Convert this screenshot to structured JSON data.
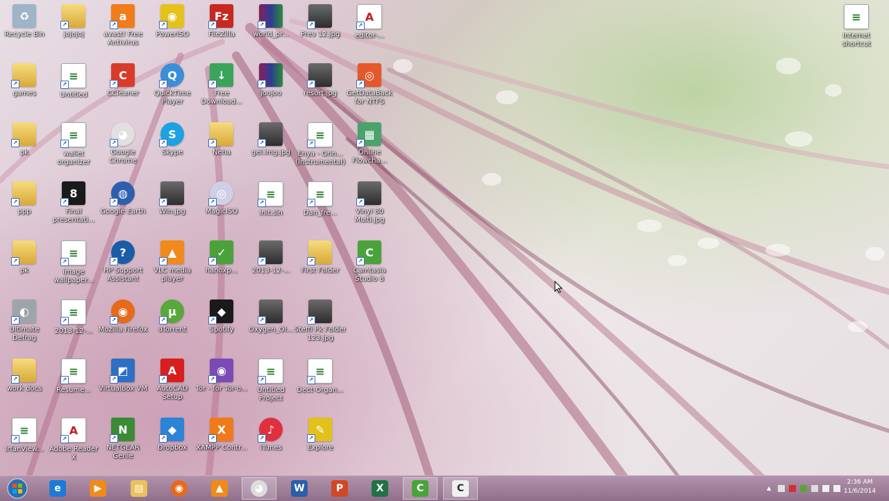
{
  "desktop": {
    "icons": [
      {
        "label": "Recycle Bin",
        "kind": "recycle",
        "color": "#9fb4c8"
      },
      {
        "label": "jojojoj",
        "kind": "folder"
      },
      {
        "label": "avast! Free Antivirus",
        "kind": "app",
        "color": "#f07c1a",
        "glyph": "a"
      },
      {
        "label": "PowerISO",
        "kind": "app",
        "color": "#e4c21a",
        "glyph": "◉"
      },
      {
        "label": "FileZilla",
        "kind": "app",
        "color": "#c7281f",
        "glyph": "Fz"
      },
      {
        "label": "world_pr...",
        "kind": "rar"
      },
      {
        "label": "Prev 12.jpg",
        "kind": "img"
      },
      {
        "label": "editor-...",
        "kind": "pdf"
      },
      {
        "label": "games",
        "kind": "folder"
      },
      {
        "label": "Untitled",
        "kind": "doc"
      },
      {
        "label": "CCleaner",
        "kind": "app",
        "color": "#d93b2b",
        "glyph": "C"
      },
      {
        "label": "QuickTime Player",
        "kind": "app",
        "color": "#3a8fd8",
        "glyph": "Q",
        "round": true
      },
      {
        "label": "Free Download...",
        "kind": "app",
        "color": "#3aa55a",
        "glyph": "↓"
      },
      {
        "label": "joojoo",
        "kind": "rar"
      },
      {
        "label": "resort.jpg",
        "kind": "img"
      },
      {
        "label": "GetDataBack for NTFS",
        "kind": "app",
        "color": "#e4582a",
        "glyph": "◎"
      },
      {
        "label": "pk",
        "kind": "folder"
      },
      {
        "label": "wallet organizer",
        "kind": "doc"
      },
      {
        "label": "Google Chrome",
        "kind": "app",
        "color": "#e0e0e0",
        "glyph": "◕",
        "round": true
      },
      {
        "label": "Skype",
        "kind": "app",
        "color": "#1da1e2",
        "glyph": "S",
        "round": true
      },
      {
        "label": "Neha",
        "kind": "folder"
      },
      {
        "label": "gel.img.jpg",
        "kind": "img"
      },
      {
        "label": "Enya - Orin... (Instrumental)",
        "kind": "doc"
      },
      {
        "label": "Online Flowcha...",
        "kind": "app",
        "color": "#4aa36a",
        "glyph": "▦"
      },
      {
        "label": "ppp",
        "kind": "folder"
      },
      {
        "label": "Final presentati...",
        "kind": "app",
        "color": "#1a1a1a",
        "glyph": "8"
      },
      {
        "label": "Google Earth",
        "kind": "app",
        "color": "#2d5fae",
        "glyph": "◍",
        "round": true
      },
      {
        "label": "Win.jpg",
        "kind": "img"
      },
      {
        "label": "MagicISO",
        "kind": "app",
        "color": "#cfcfe8",
        "glyph": "◎",
        "round": true
      },
      {
        "label": "Init.sln",
        "kind": "doc"
      },
      {
        "label": "Dan_fre...",
        "kind": "doc"
      },
      {
        "label": "Vinyl 80 Multi.jpg",
        "kind": "img"
      },
      {
        "label": "pk",
        "kind": "folder"
      },
      {
        "label": "image wallpaper...",
        "kind": "doc"
      },
      {
        "label": "HP Support Assistant",
        "kind": "app",
        "color": "#1a5ca8",
        "glyph": "?",
        "round": true
      },
      {
        "label": "VLC media player",
        "kind": "app",
        "color": "#f08a1a",
        "glyph": "▲"
      },
      {
        "label": "hanoxp...",
        "kind": "app",
        "color": "#4aa33a",
        "glyph": "✓"
      },
      {
        "label": "2013-12-...",
        "kind": "img"
      },
      {
        "label": "First Folder",
        "kind": "folder"
      },
      {
        "label": "Camtasia Studio 8",
        "kind": "app",
        "color": "#4aa33a",
        "glyph": "C"
      },
      {
        "label": "Ultimate Defrag",
        "kind": "app",
        "color": "#9da5aa",
        "glyph": "◐"
      },
      {
        "label": "2013-12-...",
        "kind": "doc"
      },
      {
        "label": "Mozilla Firefox",
        "kind": "app",
        "color": "#e56a1a",
        "glyph": "◉",
        "round": true
      },
      {
        "label": "uTorrent",
        "kind": "app",
        "color": "#59a83a",
        "glyph": "µ",
        "round": true
      },
      {
        "label": "Spotify",
        "kind": "app",
        "color": "#1a1a1a",
        "glyph": "◆"
      },
      {
        "label": "Oxygen_Ol...",
        "kind": "img"
      },
      {
        "label": "Steffi Pk Folder 123.jpg",
        "kind": "img"
      },
      {
        "label": "",
        "kind": "none"
      },
      {
        "label": "work docs",
        "kind": "folder"
      },
      {
        "label": "Resume...",
        "kind": "doc"
      },
      {
        "label": "VirtualBox VM",
        "kind": "app",
        "color": "#2d6fc3",
        "glyph": "◩"
      },
      {
        "label": "AutoCAD Setup",
        "kind": "app",
        "color": "#d81e1e",
        "glyph": "A"
      },
      {
        "label": "Tor - for Tor-o...",
        "kind": "app",
        "color": "#7a4bb5",
        "glyph": "◉"
      },
      {
        "label": "Untitled Project",
        "kind": "doc"
      },
      {
        "label": "Dect-Organ...",
        "kind": "doc"
      },
      {
        "label": "",
        "kind": "none"
      },
      {
        "label": "IrfanView...",
        "kind": "doc"
      },
      {
        "label": "Adobe Reader X",
        "kind": "pdf"
      },
      {
        "label": "NETGEAR Genie",
        "kind": "app",
        "color": "#3b8a35",
        "glyph": "N"
      },
      {
        "label": "Dropbox",
        "kind": "app",
        "color": "#2d83d6",
        "glyph": "◆"
      },
      {
        "label": "XAMPP Contr...",
        "kind": "app",
        "color": "#f07a1a",
        "glyph": "X"
      },
      {
        "label": "iTunes",
        "kind": "app",
        "color": "#e0303d",
        "glyph": "♪",
        "round": true
      },
      {
        "label": "Explore",
        "kind": "app",
        "color": "#e0c21a",
        "glyph": "✎"
      },
      {
        "label": "",
        "kind": "none"
      }
    ],
    "right_icon": {
      "label": "Internet shortcut",
      "kind": "doc"
    }
  },
  "taskbar": {
    "buttons": [
      {
        "name": "ie",
        "color": "#1d7ad6",
        "glyph": "e",
        "open": false
      },
      {
        "name": "media-player",
        "color": "#f08a1a",
        "glyph": "▶",
        "open": false
      },
      {
        "name": "file-explorer",
        "color": "#e9c25a",
        "glyph": "▤",
        "open": false
      },
      {
        "name": "firefox",
        "color": "#e56a1a",
        "glyph": "◉",
        "open": false
      },
      {
        "name": "vlc",
        "color": "#f08a1a",
        "glyph": "▲",
        "open": false
      },
      {
        "name": "chrome",
        "color": "#dcdcdc",
        "glyph": "◕",
        "open": true
      },
      {
        "name": "word",
        "color": "#2b5ea6",
        "glyph": "W",
        "open": false
      },
      {
        "name": "powerpoint",
        "color": "#d24726",
        "glyph": "P",
        "open": false
      },
      {
        "name": "excel",
        "color": "#217346",
        "glyph": "X",
        "open": false
      },
      {
        "name": "camtasia-recorder",
        "color": "#4aa33a",
        "glyph": "C",
        "open": true
      },
      {
        "name": "camtasia-studio",
        "color": "#f0f0f0",
        "glyph": "C",
        "open": true
      }
    ],
    "clock": {
      "time": "2:36 AM",
      "date": "11/6/2014"
    }
  }
}
